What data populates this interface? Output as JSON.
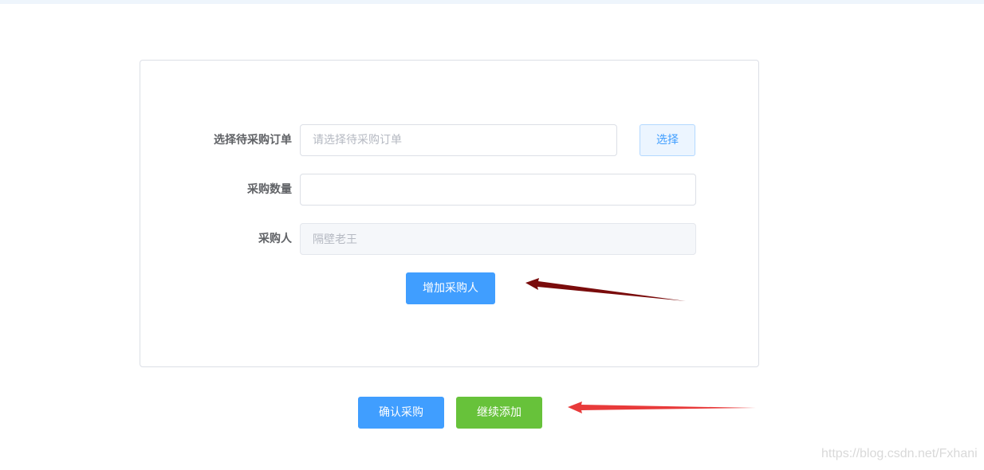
{
  "form": {
    "order": {
      "label": "选择待采购订单",
      "placeholder": "请选择待采购订单",
      "select_button": "选择"
    },
    "quantity": {
      "label": "采购数量",
      "value": ""
    },
    "purchaser": {
      "label": "采购人",
      "value": "隔壁老王"
    },
    "add_purchaser_button": "增加采购人"
  },
  "actions": {
    "confirm_button": "确认采购",
    "continue_button": "继续添加"
  },
  "colors": {
    "primary": "#409eff",
    "success": "#67c23a",
    "arrow_dark": "#7a0c0c",
    "arrow_red": "#e83a3a"
  },
  "watermark": "https://blog.csdn.net/Fxhani"
}
